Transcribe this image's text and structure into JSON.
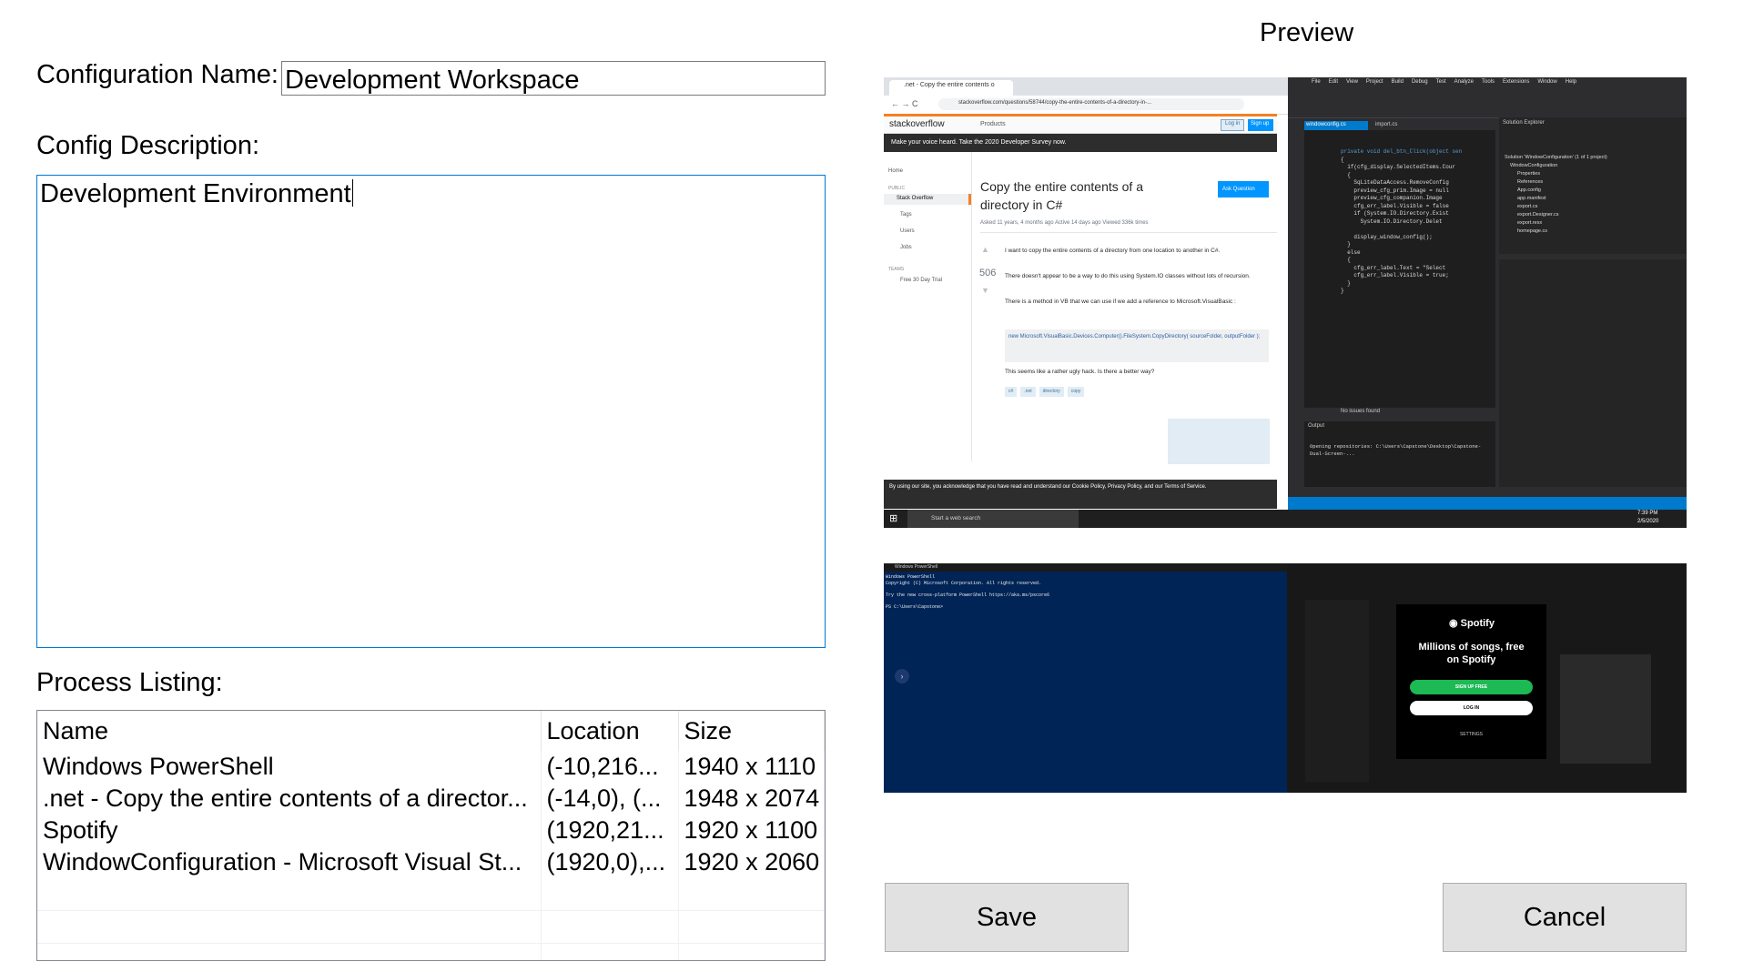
{
  "form": {
    "config_name_label": "Configuration Name:",
    "config_name_value": "Development Workspace",
    "config_desc_label": "Config Description:",
    "config_desc_value": "Development Environment",
    "process_label": "Process Listing:",
    "columns": [
      "Name",
      "Location",
      "Size"
    ],
    "rows": [
      {
        "name": "Windows PowerShell",
        "location": "(-10,216...",
        "size": "1940 x 1110"
      },
      {
        "name": ".net - Copy the entire contents of a director...",
        "location": "(-14,0), (...",
        "size": "1948 x 2074"
      },
      {
        "name": "Spotify",
        "location": "(1920,21...",
        "size": "1920 x 1100"
      },
      {
        "name": "WindowConfiguration - Microsoft Visual St...",
        "location": "(1920,0),...",
        "size": "1920 x 2060"
      }
    ],
    "save_label": "Save",
    "cancel_label": "Cancel"
  },
  "preview": {
    "title": "Preview",
    "top": {
      "so_tab": ".net - Copy the entire contents o",
      "so_url": "stackoverflow.com/questions/58744/copy-the-entire-contents-of-a-directory-in-...",
      "so_logo": "stackoverflow",
      "so_products": "Products",
      "so_login": "Log in",
      "so_signup": "Sign up",
      "so_banner": "Make your voice heard. Take the 2020 Developer Survey now.",
      "so_nav": [
        "Home",
        "PUBLIC",
        "Stack Overflow",
        "Tags",
        "Users",
        "Jobs",
        "TEAMS",
        "Free 30 Day Trial"
      ],
      "so_question": "Copy the entire contents of a directory in C#",
      "so_ask": "Ask Question",
      "so_meta": "Asked 11 years, 4 months ago   Active 14 days ago   Viewed 336k times",
      "so_votes": "506",
      "so_body1": "I want to copy the entire contents of a directory from one location to another in C#.",
      "so_body2": "There doesn't appear to be a way to do this using System.IO classes without lots of recursion.",
      "so_body3": "There is a method in VB that we can use if we add a reference to Microsoft.VisualBasic :",
      "so_code": "new Microsoft.VisualBasic.Devices.Computer().FileSystem.CopyDirectory( sourceFolder, outputFolder );",
      "so_body4": "This seems like a rather ugly hack. Is there a better way?",
      "so_tags": [
        "c#",
        ".net",
        "directory",
        "copy"
      ],
      "so_cookie": "By using our site, you acknowledge that you have read and understand our Cookie Policy, Privacy Policy, and our Terms of Service.",
      "vs_menu": [
        "File",
        "Edit",
        "View",
        "Project",
        "Build",
        "Debug",
        "Test",
        "Analyze",
        "Tools",
        "Extensions",
        "Window",
        "Help"
      ],
      "vs_tab1": "windowconfig.cs",
      "vs_tab2": "import.cs",
      "vs_code": [
        "private void del_btn_Click(object sen",
        "{",
        "  if(cfg_display.SelectedItems.Cour",
        "  {",
        "    SqLiteDataAccess.RemoveConfig",
        "    preview_cfg_prim.Image = null",
        "    preview_cfg_companion.Image",
        "    cfg_err_label.Visible = false",
        "    if (System.IO.Directory.Exist",
        "      System.IO.Directory.Delet",
        "",
        "    display_window_config();",
        "  }",
        "  else",
        "  {",
        "    cfg_err_label.Text = \"Select",
        "    cfg_err_label.Visible = true;",
        "  }",
        "}"
      ],
      "vs_solution_title": "Solution Explorer",
      "vs_solution": [
        "Solution 'WindowConfiguration' (1 of 1 project)",
        "WindowConfiguration",
        "Properties",
        "References",
        "App.config",
        "app.manifest",
        "export.cs",
        "export.Designer.cs",
        "export.resx",
        "homepage.cs"
      ],
      "vs_output_title": "Output",
      "vs_output": "Opening repositories: C:\\Users\\Capstone\\Desktop\\Capstone-Dual-Screen-...",
      "vs_status": "No issues found",
      "taskbar_search": "Start a web search",
      "taskbar_time": "7:39 PM",
      "taskbar_date": "2/5/2020"
    },
    "bottom": {
      "ps_title": "Windows PowerShell",
      "ps_lines": [
        "Windows PowerShell",
        "Copyright (C) Microsoft Corporation. All rights reserved.",
        "",
        "Try the new cross-platform PowerShell https://aka.ms/pscore6",
        "",
        "PS C:\\Users\\Capstone>"
      ],
      "sp_brand": "Spotify",
      "sp_tagline": "Millions of songs, free on Spotify",
      "sp_signup": "SIGN UP FREE",
      "sp_login": "LOG IN",
      "sp_settings": "SETTINGS"
    }
  },
  "colors": {
    "accent": "#0078d7",
    "button_bg": "#e1e1e1",
    "ps_bg": "#012456",
    "spotify_green": "#1db954"
  }
}
